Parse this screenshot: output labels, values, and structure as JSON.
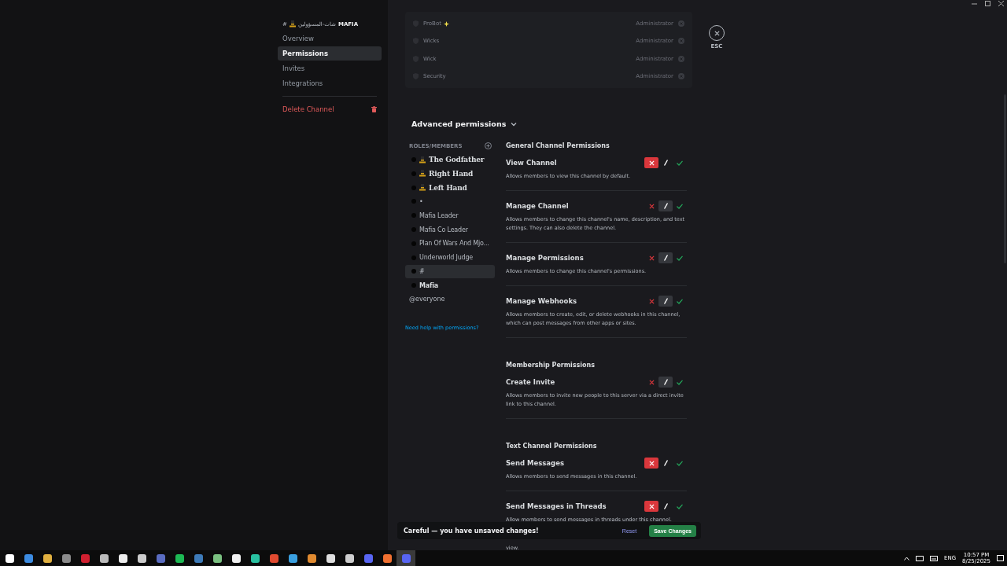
{
  "sidebar": {
    "channel_title": {
      "prefix": "#",
      "name": "شات-المسؤولين",
      "server": "MAFIA"
    },
    "items": [
      {
        "label": "Overview",
        "selected": false
      },
      {
        "label": "Permissions",
        "selected": true
      },
      {
        "label": "Invites",
        "selected": false
      },
      {
        "label": "Integrations",
        "selected": false
      }
    ],
    "danger_item": {
      "label": "Delete Channel"
    }
  },
  "members": [
    {
      "name": "ProBot",
      "sparkle": true,
      "role": "Administrator"
    },
    {
      "name": "Wicks",
      "sparkle": false,
      "role": "Administrator"
    },
    {
      "name": "Wick",
      "sparkle": false,
      "role": "Administrator"
    },
    {
      "name": "Security",
      "sparkle": false,
      "role": "Administrator"
    }
  ],
  "close": {
    "label": "ESC"
  },
  "advanced": {
    "title": "Advanced permissions",
    "expanded": true
  },
  "roles": {
    "header": "ROLES/MEMBERS",
    "items": [
      {
        "name": "The Godfather",
        "hat": true,
        "selected": false
      },
      {
        "name": "Right Hand",
        "hat": true,
        "selected": false
      },
      {
        "name": "Left Hand",
        "hat": true,
        "selected": false
      },
      {
        "name": "•",
        "hat": false,
        "selected": false
      },
      {
        "name": "Mafia Leader",
        "hat": false,
        "selected": false
      },
      {
        "name": "Mafia Co Leader",
        "hat": false,
        "selected": false
      },
      {
        "name": "Plan Of Wars And Mjo...",
        "hat": false,
        "selected": false
      },
      {
        "name": "Underworld Judge",
        "hat": false,
        "selected": false
      },
      {
        "name": "#",
        "hat": false,
        "selected": true
      },
      {
        "name": "Mafia",
        "hat": false,
        "selected": false
      }
    ],
    "everyone": "@everyone",
    "help_link": "Need help with permissions?"
  },
  "permission_groups": [
    {
      "title": "General Channel Permissions",
      "items": [
        {
          "name": "View Channel",
          "description": "Allows members to view this channel by default.",
          "denied": true,
          "allowed": false
        },
        {
          "name": "Manage Channel",
          "description": "Allows members to change this channel's name, description, and text settings. They can also delete the channel.",
          "denied": false,
          "allowed": false
        },
        {
          "name": "Manage Permissions",
          "description": "Allows members to change this channel's permissions.",
          "denied": false,
          "allowed": false
        },
        {
          "name": "Manage Webhooks",
          "description": "Allows members to create, edit, or delete webhooks in this channel, which can post messages from other apps or sites.",
          "denied": false,
          "allowed": false
        }
      ]
    },
    {
      "title": "Membership Permissions",
      "items": [
        {
          "name": "Create Invite",
          "description": "Allows members to invite new people to this server via a direct invite link to this channel.",
          "denied": false,
          "allowed": false
        }
      ]
    },
    {
      "title": "Text Channel Permissions",
      "items": [
        {
          "name": "Send Messages",
          "description": "Allows members to send messages in this channel.",
          "denied": true,
          "allowed": false
        },
        {
          "name": "Send Messages in Threads",
          "description": "Allow members to send messages in threads under this channel.",
          "denied": true,
          "allowed": false
        }
      ]
    }
  ],
  "cut_text": "view.",
  "unsaved_bar": {
    "message": "Careful — you have unsaved changes!",
    "reset": "Reset",
    "save": "Save Changes"
  },
  "taskbar": {
    "apps": [
      {
        "color": "#ffffff"
      },
      {
        "color": "#3c8be0"
      },
      {
        "color": "#e0b040"
      },
      {
        "color": "#8a8a8a"
      },
      {
        "color": "#d02030"
      },
      {
        "color": "#bbbbbb"
      },
      {
        "color": "#eeeeee"
      },
      {
        "color": "#cccccc"
      },
      {
        "color": "#5a6cc0"
      },
      {
        "color": "#1db954"
      },
      {
        "color": "#3d7ab8"
      },
      {
        "color": "#7ac080"
      },
      {
        "color": "#f0f0f0"
      },
      {
        "color": "#28c0a0"
      },
      {
        "color": "#e04a30"
      },
      {
        "color": "#3aa0e0"
      },
      {
        "color": "#e08a30"
      },
      {
        "color": "#dddddd"
      },
      {
        "color": "#cccccc"
      },
      {
        "color": "#5865f2"
      },
      {
        "color": "#f07030"
      },
      {
        "color": "#5865f2"
      }
    ],
    "language": "ENG",
    "time": "10:57 PM",
    "date": "8/25/2025"
  }
}
